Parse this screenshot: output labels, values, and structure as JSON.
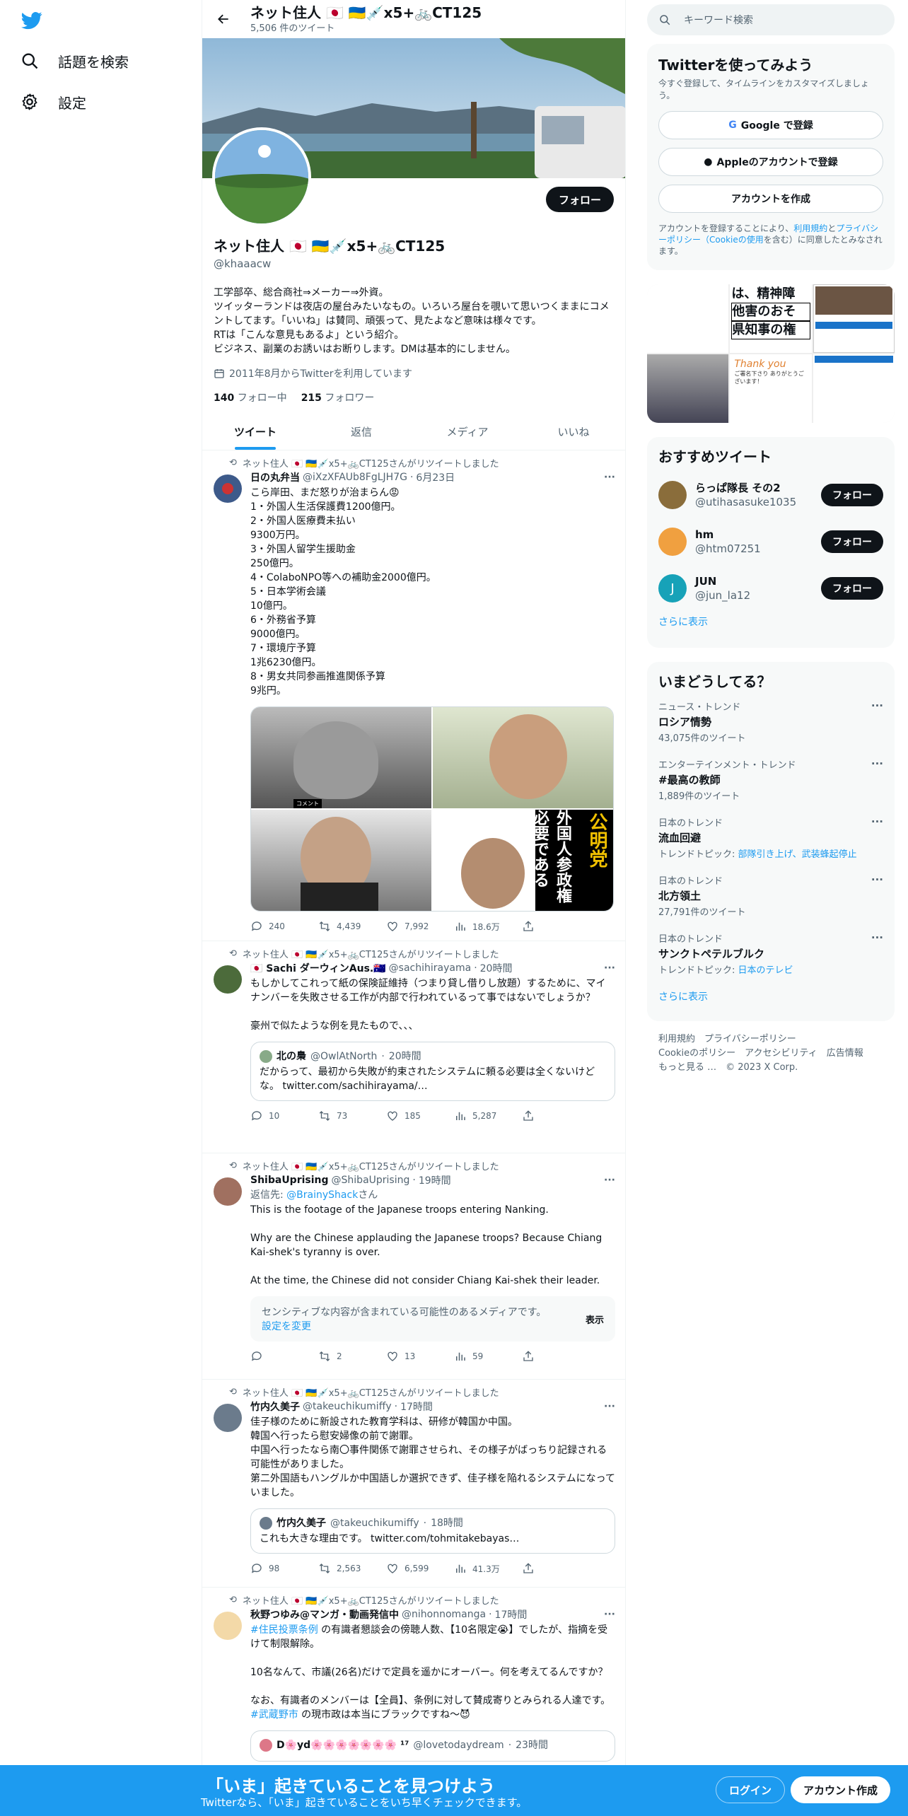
{
  "nav": {
    "explore": "話題を検索",
    "settings": "設定"
  },
  "header": {
    "name": "ネット住人 🇯🇵 🇺🇦💉x5+🚲CT125",
    "tweet_count": "5,506 件のツイート"
  },
  "profile": {
    "name": "ネット住人 🇯🇵 🇺🇦💉x5+🚲CT125",
    "handle": "@khaaacw",
    "follow_label": "フォロー",
    "bio": "工学部卒、総合商社⇒メーカー⇒外資。\nツイッターランドは夜店の屋台みたいなもの。いろいろ屋台を覗いて思いつくままにコメントしてます。「いいね」は賛同、頑張って、見たよなど意味は様々です。\nRTは「こんな意見もあるよ」という紹介。\nビジネス、副業のお誘いはお断りします。DMは基本的にしません。",
    "joined": "2011年8月からTwitterを利用しています",
    "following_count": "140",
    "following_label": "フォロー中",
    "followers_count": "215",
    "followers_label": "フォロワー"
  },
  "tabs": [
    "ツイート",
    "返信",
    "メディア",
    "いいね"
  ],
  "retweet_label": "ネット住人 🇯🇵 🇺🇦💉x5+🚲CT125さんがリツイートしました",
  "tweets": [
    {
      "author": "日の丸弁当",
      "handle": "@iXzXFAUb8FgLJH7G",
      "time": "6月23日",
      "text": "こら岸田、まだ怒りが治まらん😡\n1・外国人生活保護費1200億円。\n2・外国人医療費未払い\n9300万円。\n3・外国人留学生援助金\n250億円。\n4・ColaboNPO等への補助金2000億円。\n5・日本学術会議\n10億円。\n6・外務省予算\n9000億円。\n7・環境庁予算\n1兆6230億円。\n8・男女共同参画推進関係予算\n9兆円。",
      "media_text": [
        "公明党",
        "外国人参政権必要である",
        "コメント"
      ],
      "replies": "240",
      "retweets": "4,439",
      "likes": "7,992",
      "views": "18.6万"
    },
    {
      "author": "🇯🇵 Sachi ダーウィンAus.🇦🇺",
      "handle": "@sachihirayama",
      "time": "20時間",
      "text": "もしかしてこれって紙の保険証維持（つまり貸し借りし放題）するために、マイナンバーを失敗させる工作が内部で行われているって事ではないでしょうか？\n\n豪州で似たような例を見たもので、、、",
      "quote": {
        "author": "北の梟",
        "handle": "@OwlAtNorth",
        "time": "20時間",
        "text": "だからって、最初から失敗が約束されたシステムに頼る必要は全くないけどな。 twitter.com/sachihirayama/…"
      },
      "replies": "10",
      "retweets": "73",
      "likes": "185",
      "views": "5,287"
    },
    {
      "author": "ShibaUprising",
      "handle": "@ShibaUprising",
      "time": "19時間",
      "reply_to": "返信先: ",
      "reply_handle": "@BrainyShack",
      "reply_suffix": "さん",
      "text": "This is the footage of the Japanese troops entering Nanking.\n\nWhy are the Chinese applauding the Japanese troops?  Because Chiang Kai-shek's tyranny is over.\n\nAt the time, the Chinese did not consider Chiang Kai-shek their leader.",
      "sensitive": "センシティブな内容が含まれている可能性のあるメディアです。",
      "sensitive_link": "設定を変更",
      "show": "表示",
      "replies": "",
      "retweets": "2",
      "likes": "13",
      "views": "59"
    },
    {
      "author": "竹内久美子",
      "handle": "@takeuchikumiffy",
      "time": "17時間",
      "text": "佳子様のために新設された教育学科は、研修が韓国か中国。\n韓国へ行ったら慰安婦像の前で謝罪。\n中国へ行ったなら南〇事件関係で謝罪させられ、その様子がばっちり記録される可能性がありました。\n第二外国語もハングルか中国語しか選択できず、佳子様を陥れるシステムになっていました。",
      "quote": {
        "author": "竹内久美子",
        "handle": "@takeuchikumiffy",
        "time": "18時間",
        "text": "これも大きな理由です。 twitter.com/tohmitakebayas…"
      },
      "replies": "98",
      "retweets": "2,563",
      "likes": "6,599",
      "views": "41.3万"
    },
    {
      "author": "秋野つゆみ@マンガ・動画発信中",
      "handle": "@nihonnomanga",
      "time": "17時間",
      "text_pre": "#住民投票条例",
      "text": " の有識者懇談会の傍聴人数、【10名限定😭】でしたが、指摘を受けて制限解除。\n\n10名なんて、市議(26名)だけで定員を遥かにオーバー。何を考えてるんですか？\n\nなお、有識者のメンバーは【全員】、条例に対して賛成寄りとみられる人達です。",
      "text_tag2": "#武蔵野市",
      "text_post": " の現市政は本当にブラックですね〜😈",
      "quote_author": "D🌸yd🌸🌸🌸🌸🌸🌸🌸 ¹⁷",
      "quote_handle": "@lovetodaydream",
      "quote_time": "23時間"
    }
  ],
  "right": {
    "search_placeholder": "キーワード検索",
    "signup_title": "Twitterを使ってみよう",
    "signup_sub": "今すぐ登録して、タイムラインをカスタマイズしましょう。",
    "google": "Google で登録",
    "apple": "Appleのアカウントで登録",
    "create": "アカウントを作成",
    "terms_pre": "アカウントを登録することにより、",
    "terms_link1": "利用規約",
    "terms_and": "と",
    "terms_link2": "プライバシーポリシー",
    "terms_link3": "（Cookieの使用",
    "terms_post": "を含む）に同意したとみなされます。",
    "recommend_title": "おすすめツイート",
    "suggestions": [
      {
        "name": "らっぱ隊長 その2",
        "handle": "@utihasasuke1035",
        "initial": "",
        "color": "#8a6d3b"
      },
      {
        "name": "hm",
        "handle": "@htm07251",
        "initial": "",
        "color": "#f0a040"
      },
      {
        "name": "JUN",
        "handle": "@jun_la12",
        "initial": "J",
        "color": "#17a2b8"
      }
    ],
    "suggest_follow": "フォロー",
    "show_more": "さらに表示",
    "trends_title": "いまどうしてる？",
    "trends": [
      {
        "cat": "ニュース・トレンド",
        "name": "ロシア情勢",
        "sub": "43,075件のツイート",
        "topic_label": "",
        "topics": ""
      },
      {
        "cat": "エンターテインメント・トレンド",
        "name": "#最高の教師",
        "sub": "1,889件のツイート",
        "topic_label": "",
        "topics": ""
      },
      {
        "cat": "日本のトレンド",
        "name": "流血回避",
        "sub": "",
        "topic_label": "トレンドトピック: ",
        "topics": "部隊引き上げ、武装蜂起停止"
      },
      {
        "cat": "日本のトレンド",
        "name": "北方領土",
        "sub": "27,791件のツイート",
        "topic_label": "",
        "topics": ""
      },
      {
        "cat": "日本のトレンド",
        "name": "サンクトペテルブルク",
        "sub": "",
        "topic_label": "トレンドトピック: ",
        "topics": "日本のテレビ"
      }
    ],
    "footer": "利用規約　プライバシーポリシー\nCookieのポリシー　アクセシビリティ　広告情報\nもっと見る …　© 2023 X Corp.",
    "image_texts": [
      "は、精神障",
      "他害のおそ",
      "県知事の権",
      "Thank you",
      "ご署名下さり ありがとうございます！"
    ]
  },
  "bottom": {
    "title": "「いま」起きていることを見つけよう",
    "sub": "Twitterなら、「いま」起きていることをいち早くチェックできます。",
    "login": "ログイン",
    "signup": "アカウント作成"
  },
  "colors": {
    "accent": "#1d9bf0",
    "text": "#0f1419",
    "muted": "#536471"
  }
}
